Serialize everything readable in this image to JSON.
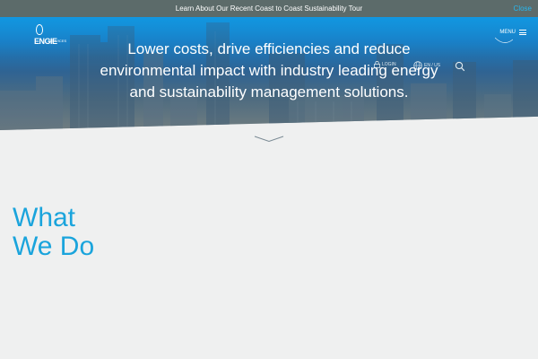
{
  "announcement": {
    "text": "Learn About Our Recent Coast to Coast Sustainability Tour",
    "close_label": "Close"
  },
  "logo": {
    "wordmark": "ENGIE",
    "subtext": "SERVICES"
  },
  "nav": {
    "menu_label": "MENU",
    "login_label": "LOGIN",
    "language_label": "EN / US"
  },
  "hero": {
    "headline": "Lower costs, drive efficiencies and reduce environmental impact with industry leading energy and sustainability management solutions."
  },
  "section": {
    "title_line1": "What",
    "title_line2": "We Do"
  },
  "colors": {
    "accent": "#1aa4dc",
    "topbar": "#5c6b6a",
    "close_link": "#27b7ef",
    "page_bg": "#eff0f0"
  },
  "icons": [
    "hamburger-icon",
    "lock-icon",
    "globe-icon",
    "search-icon",
    "chevron-down-icon"
  ]
}
